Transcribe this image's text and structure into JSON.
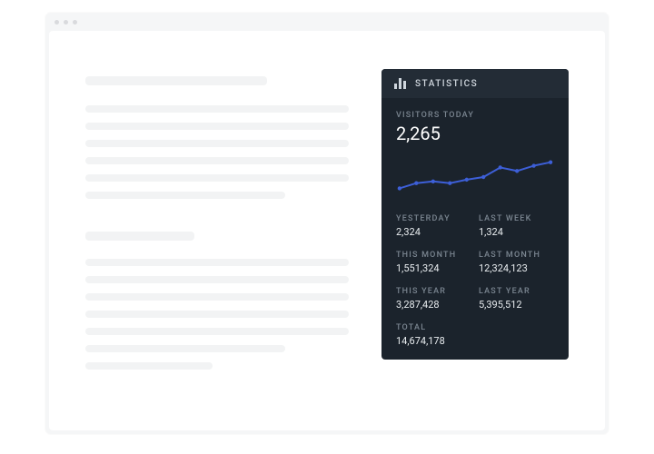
{
  "stats": {
    "header": "STATISTICS",
    "primary_label": "VISITORS TODAY",
    "primary_value": "2,265",
    "pairs": [
      {
        "left_label": "YESTERDAY",
        "left_value": "2,324",
        "right_label": "LAST WEEK",
        "right_value": "1,324"
      },
      {
        "left_label": "THIS MONTH",
        "left_value": "1,551,324",
        "right_label": "LAST MONTH",
        "right_value": "12,324,123"
      },
      {
        "left_label": "THIS YEAR",
        "left_value": "3,287,428",
        "right_label": "LAST YEAR",
        "right_value": "5,395,512"
      }
    ],
    "total_label": "TOTAL",
    "total_value": "14,674,178"
  },
  "chart_data": {
    "type": "line",
    "x": [
      0,
      1,
      2,
      3,
      4,
      5,
      6,
      7,
      8,
      9
    ],
    "values": [
      12,
      18,
      20,
      18,
      22,
      25,
      36,
      32,
      38,
      42
    ],
    "ylim": [
      0,
      50
    ],
    "color": "#3d5fd8",
    "title": "",
    "xlabel": "",
    "ylabel": ""
  }
}
